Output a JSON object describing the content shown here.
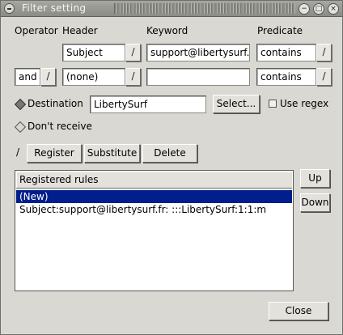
{
  "window": {
    "title": "Filter setting",
    "controls": {
      "minimize": "−",
      "maximize": "□",
      "close": "×"
    }
  },
  "columns": {
    "operator": "Operator",
    "header": "Header",
    "keyword": "Keyword",
    "predicate": "Predicate"
  },
  "row1": {
    "header_value": "Subject",
    "keyword_value": "support@libertysurf.fr",
    "predicate_value": "contains"
  },
  "row2": {
    "operator_value": "and",
    "header_value": "(none)",
    "keyword_value": "",
    "predicate_value": "contains"
  },
  "destination": {
    "label": "Destination",
    "value": "LibertySurf",
    "select_button": "Select...",
    "use_regex_label": "Use regex",
    "use_regex_checked": false,
    "selected": true
  },
  "dont_receive": {
    "label": "Don't receive",
    "selected": false
  },
  "actions": {
    "register": "Register",
    "substitute": "Substitute",
    "delete": "Delete"
  },
  "rules": {
    "header": "Registered rules",
    "items": [
      {
        "text": "(New)",
        "selected": true
      },
      {
        "text": "Subject:support@libertysurf.fr: :::LibertySurf:1:1:m",
        "selected": false
      }
    ]
  },
  "side_buttons": {
    "up": "Up",
    "down": "Down"
  },
  "close_button": "Close",
  "icons": {
    "combo_arrow": "/",
    "window_menu": "circle-menu-icon"
  }
}
